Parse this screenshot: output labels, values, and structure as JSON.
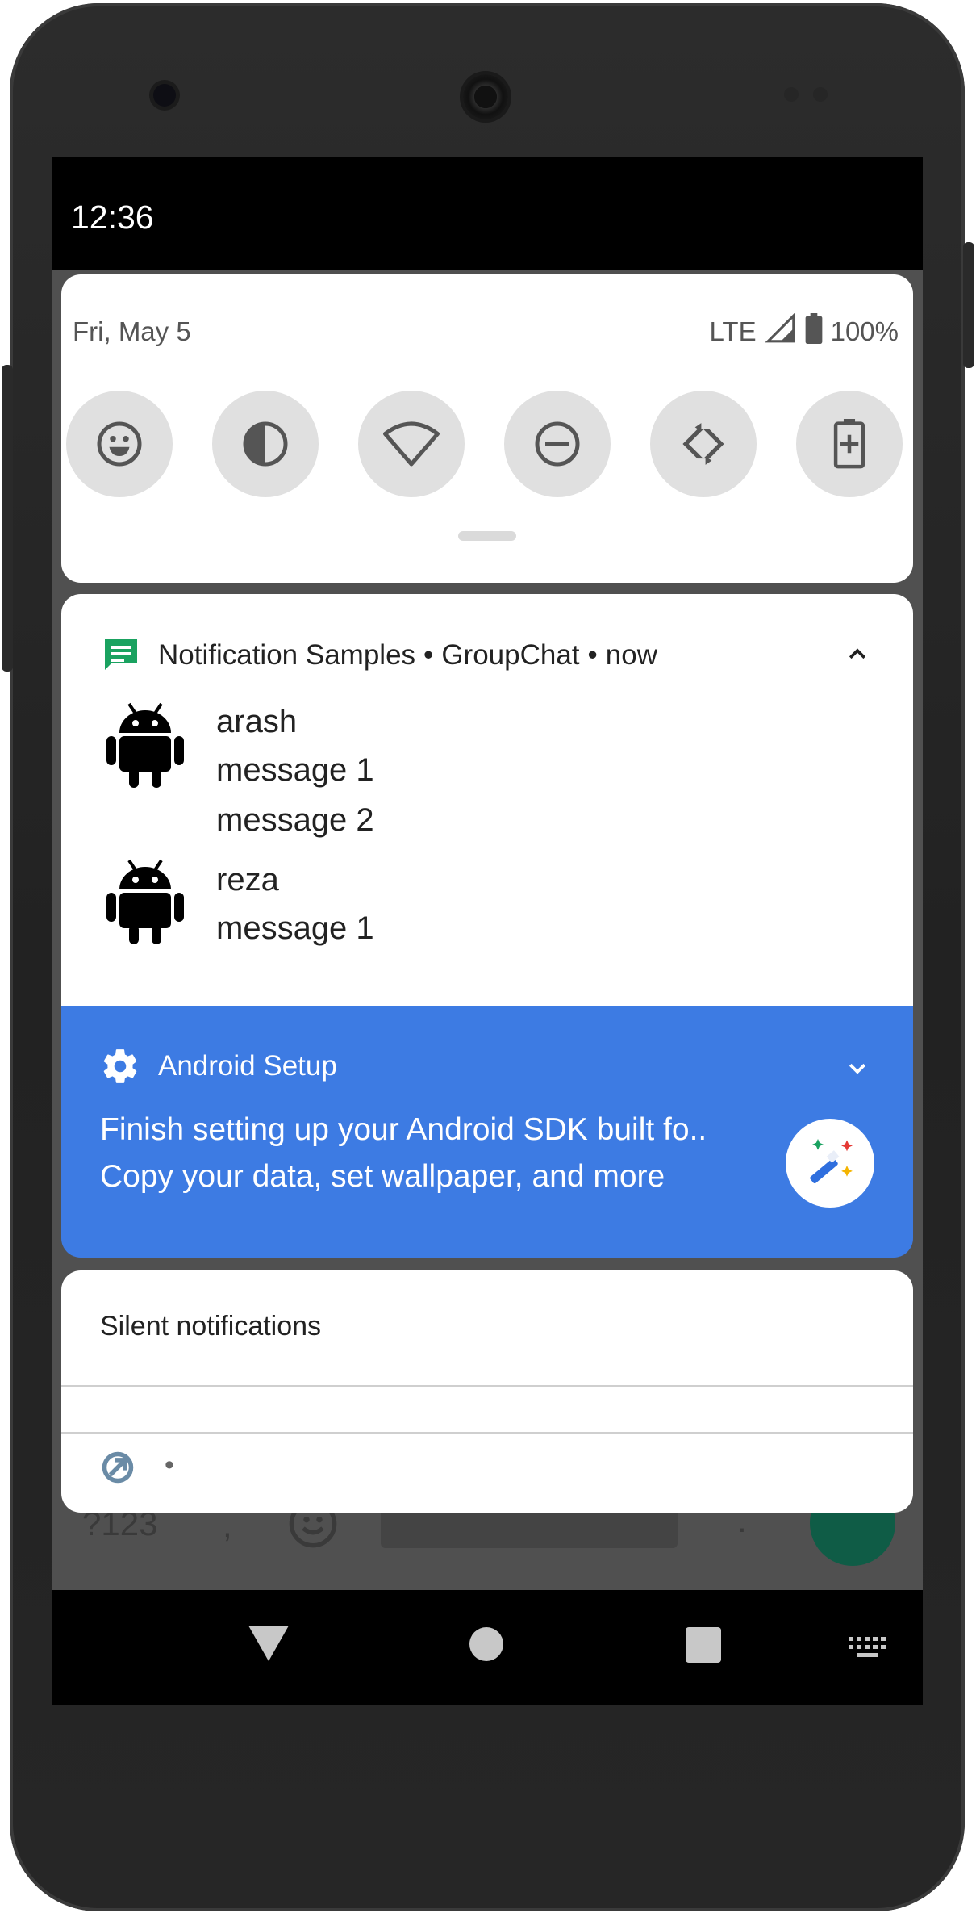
{
  "status_bar": {
    "time": "12:36"
  },
  "quick_settings": {
    "date": "Fri, May 5",
    "network": "LTE",
    "battery": "100%",
    "tiles": [
      "emoji-icon",
      "invert-colors-icon",
      "wifi-icon",
      "do-not-disturb-icon",
      "auto-rotate-icon",
      "battery-saver-icon"
    ]
  },
  "group_chat": {
    "app_name": "Notification Samples",
    "separator": "•",
    "channel": "GroupChat",
    "time": "now",
    "conversations": [
      {
        "sender": "arash",
        "messages": [
          "message 1",
          "message 2"
        ]
      },
      {
        "sender": "reza",
        "messages": [
          "message 1"
        ]
      }
    ]
  },
  "setup": {
    "app_name": "Android Setup",
    "title": "Finish setting up your Android SDK built fo..",
    "text": "Copy your data, set wallpaper, and more",
    "accent": "#3d7be3"
  },
  "silent": {
    "label": "Silent notifications",
    "row_separator": "•"
  },
  "keyboard_behind": {
    "symbols_key": "?123",
    "comma_key": ",",
    "period_key": "."
  }
}
